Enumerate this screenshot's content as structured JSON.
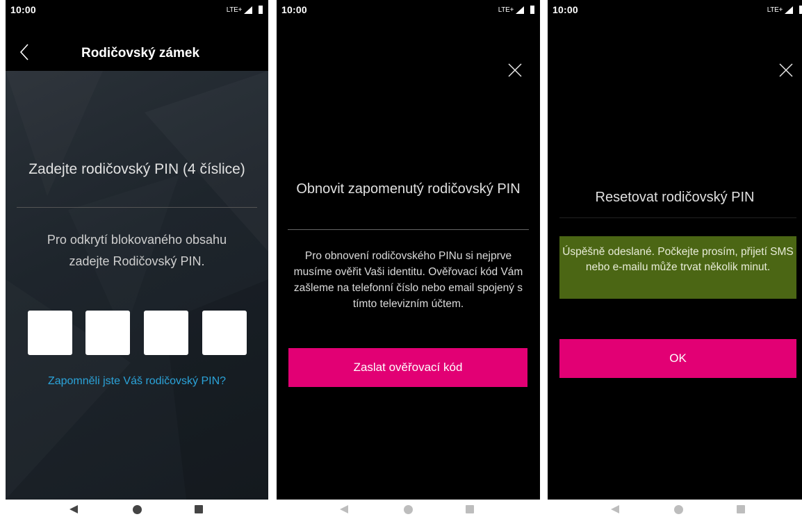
{
  "status": {
    "time": "10:00",
    "network": "LTE+"
  },
  "screen1": {
    "title": "Rodičovský zámek",
    "heading": "Zadejte rodičovský PIN (4 číslice)",
    "body": "Pro odkrytí blokovaného obsahu zadejte Rodičovský PIN.",
    "pin_digits": [
      "",
      "",
      "",
      ""
    ],
    "forgot_link": "Zapomněli jste Váš rodičovský PIN?"
  },
  "screen2": {
    "heading": "Obnovit zapomenutý rodičovský PIN",
    "body": "Pro obnovení rodičovského PINu si nejprve musíme ověřit Vaši identitu. Ověřovací kód Vám zašleme na telefonní číslo nebo email spojený s tímto televizním účtem.",
    "button": "Zaslat ověřovací kód"
  },
  "screen3": {
    "heading": "Resetovat rodičovský PIN",
    "banner": "Úspěšně odeslané. Počkejte prosím, přijetí SMS nebo e-mailu může trvat několik minut.",
    "button": "OK"
  },
  "colors": {
    "brand": "#e20074",
    "success": "#4b6614",
    "link": "#2ba3d9"
  },
  "icons": [
    "back-icon",
    "close-icon",
    "signal-icon",
    "battery-icon",
    "nav-back-icon",
    "nav-home-icon",
    "nav-recents-icon"
  ]
}
